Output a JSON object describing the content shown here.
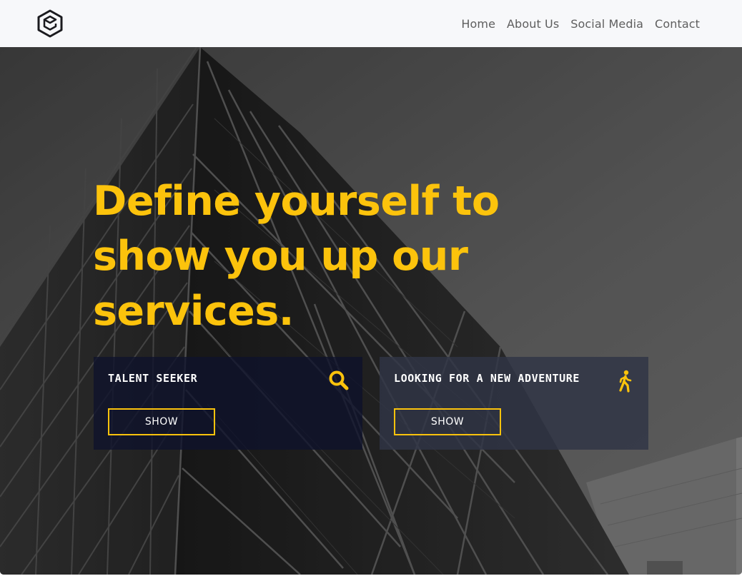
{
  "nav": {
    "logo_icon": "hexagon-cube-logo",
    "links": [
      "Home",
      "About Us",
      "Social Media",
      "Contact"
    ]
  },
  "hero": {
    "headline": "Define yourself to show you up our services.",
    "accent_color": "#fcc30c",
    "cards": [
      {
        "title": "TALENT SEEKER",
        "icon": "search-icon",
        "button": "SHOW"
      },
      {
        "title": "LOOKING FOR A NEW ADVENTURE",
        "icon": "walking-person-icon",
        "button": "SHOW"
      }
    ]
  }
}
